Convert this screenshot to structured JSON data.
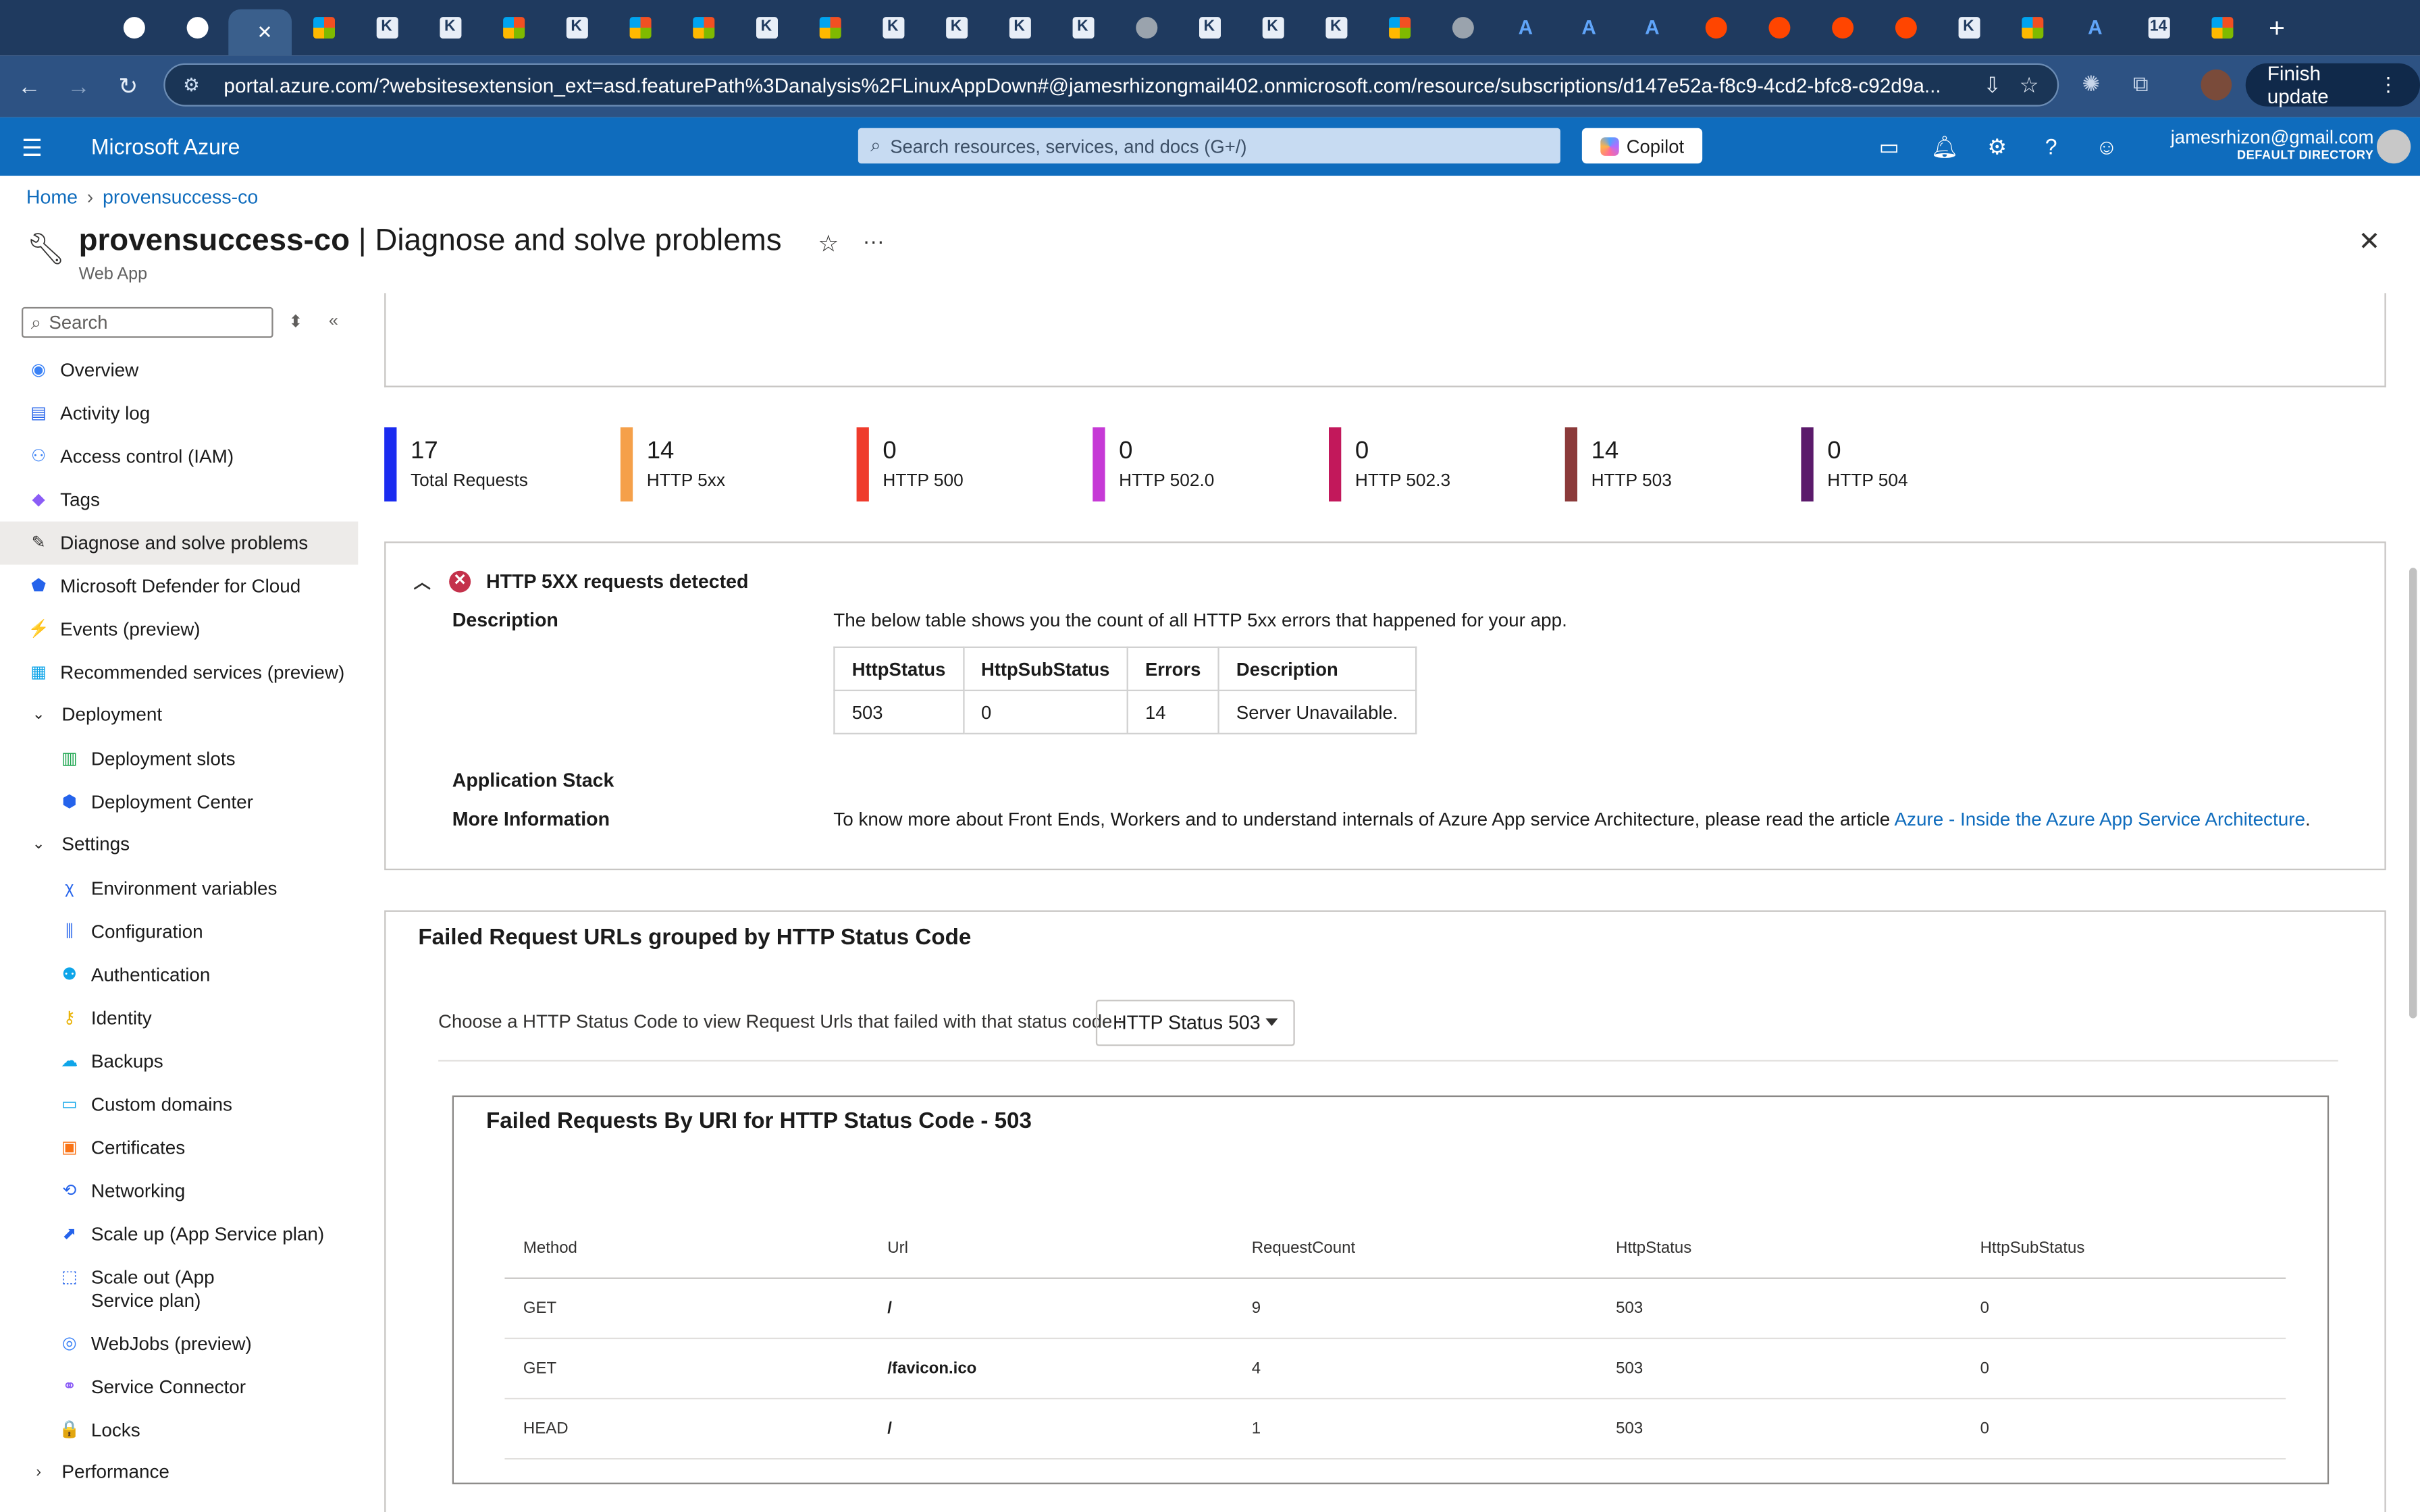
{
  "browser": {
    "tabs": [
      {
        "icon": "github-icon",
        "type": "gh"
      },
      {
        "icon": "refresh-icon",
        "type": "gh"
      },
      {
        "icon": "active-tab",
        "type": "active"
      },
      {
        "icon": "microsoft-icon",
        "type": "ms"
      },
      {
        "icon": "k-icon",
        "type": "k"
      },
      {
        "icon": "k-icon",
        "type": "k"
      },
      {
        "icon": "microsoft-icon",
        "type": "ms"
      },
      {
        "icon": "k-icon",
        "type": "k"
      },
      {
        "icon": "microsoft-icon",
        "type": "ms"
      },
      {
        "icon": "microsoft-icon",
        "type": "ms"
      },
      {
        "icon": "k-icon",
        "type": "k"
      },
      {
        "icon": "microsoft-icon",
        "type": "ms"
      },
      {
        "icon": "k-icon",
        "type": "k"
      },
      {
        "icon": "k-icon",
        "type": "k"
      },
      {
        "icon": "k-icon",
        "type": "k"
      },
      {
        "icon": "k-icon",
        "type": "k"
      },
      {
        "icon": "globe-icon",
        "type": "gl"
      },
      {
        "icon": "k-icon",
        "type": "k"
      },
      {
        "icon": "k-icon",
        "type": "k"
      },
      {
        "icon": "k-icon",
        "type": "k"
      },
      {
        "icon": "microsoft-icon",
        "type": "ms"
      },
      {
        "icon": "globe-icon",
        "type": "gl"
      },
      {
        "icon": "azure-icon",
        "type": "az"
      },
      {
        "icon": "azure-icon",
        "type": "az"
      },
      {
        "icon": "azure-icon",
        "type": "az"
      },
      {
        "icon": "reddit-icon",
        "type": "rd"
      },
      {
        "icon": "reddit-icon",
        "type": "rd"
      },
      {
        "icon": "reddit-icon",
        "type": "rd"
      },
      {
        "icon": "reddit-icon",
        "type": "rd"
      },
      {
        "icon": "k-icon",
        "type": "k"
      },
      {
        "icon": "microsoft-icon",
        "type": "ms"
      },
      {
        "icon": "azure-icon",
        "type": "az"
      },
      {
        "icon": "calendar-icon",
        "type": "k"
      },
      {
        "icon": "microsoft-icon",
        "type": "ms"
      }
    ],
    "k_letter": "K",
    "az_letter": "A",
    "calendar_num": "14",
    "close_glyph": "✕",
    "newtab_glyph": "+",
    "url": "portal.azure.com/?websitesextension_ext=asd.featurePath%3Danalysis%2FLinuxAppDown#@jamesrhizongmail402.onmicrosoft.com/resource/subscriptions/d147e52a-f8c9-4cd2-bfc8-c92d9a...",
    "finish_update": "Finish update"
  },
  "azure": {
    "brand": "Microsoft Azure",
    "search_placeholder": "Search resources, services, and docs (G+/)",
    "copilot": "Copilot",
    "user_email": "jamesrhizon@gmail.com",
    "user_directory": "DEFAULT DIRECTORY"
  },
  "breadcrumb": {
    "home": "Home",
    "resource": "provensuccess-co"
  },
  "page": {
    "title_resource": "provensuccess-co",
    "title_rest": " | Diagnose and solve problems",
    "subtitle": "Web App"
  },
  "sidebar": {
    "search_placeholder": "Search",
    "items": [
      {
        "label": "Overview",
        "icon": "overview-icon",
        "color": "#3b82f6",
        "indent": 0,
        "glyph": "◉"
      },
      {
        "label": "Activity log",
        "icon": "activity-log-icon",
        "color": "#2563eb",
        "indent": 0,
        "glyph": "▤"
      },
      {
        "label": "Access control (IAM)",
        "icon": "iam-icon",
        "color": "#3b82f6",
        "indent": 0,
        "glyph": "⚇"
      },
      {
        "label": "Tags",
        "icon": "tag-icon",
        "color": "#8b5cf6",
        "indent": 0,
        "glyph": "◆"
      },
      {
        "label": "Diagnose and solve problems",
        "icon": "wrench-icon",
        "color": "#323130",
        "indent": 0,
        "glyph": "✎",
        "selected": true
      },
      {
        "label": "Microsoft Defender for Cloud",
        "icon": "shield-icon",
        "color": "#2563eb",
        "indent": 0,
        "glyph": "⬟"
      },
      {
        "label": "Events (preview)",
        "icon": "lightning-icon",
        "color": "#eab308",
        "indent": 0,
        "glyph": "⚡"
      },
      {
        "label": "Recommended services (preview)",
        "icon": "grid-icon",
        "color": "#0ea5e9",
        "indent": 0,
        "glyph": "▦"
      },
      {
        "label": "Deployment",
        "icon": "chevron-down-icon",
        "group": true,
        "glyph": "⌄"
      },
      {
        "label": "Deployment slots",
        "icon": "deployment-slots-icon",
        "color": "#16a34a",
        "indent": 1,
        "glyph": "▥"
      },
      {
        "label": "Deployment Center",
        "icon": "deployment-center-icon",
        "color": "#2563eb",
        "indent": 1,
        "glyph": "⬢"
      },
      {
        "label": "Settings",
        "icon": "chevron-down-icon",
        "group": true,
        "glyph": "⌄"
      },
      {
        "label": "Environment variables",
        "icon": "variables-icon",
        "color": "#2563eb",
        "indent": 1,
        "glyph": "χ"
      },
      {
        "label": "Configuration",
        "icon": "configuration-icon",
        "color": "#2563eb",
        "indent": 1,
        "glyph": "⫼"
      },
      {
        "label": "Authentication",
        "icon": "authentication-icon",
        "color": "#0ea5e9",
        "indent": 1,
        "glyph": "⚉"
      },
      {
        "label": "Identity",
        "icon": "identity-icon",
        "color": "#eab308",
        "indent": 1,
        "glyph": "⚷"
      },
      {
        "label": "Backups",
        "icon": "backups-icon",
        "color": "#0ea5e9",
        "indent": 1,
        "glyph": "☁"
      },
      {
        "label": "Custom domains",
        "icon": "custom-domains-icon",
        "color": "#0ea5e9",
        "indent": 1,
        "glyph": "▭"
      },
      {
        "label": "Certificates",
        "icon": "certificates-icon",
        "color": "#f97316",
        "indent": 1,
        "glyph": "▣"
      },
      {
        "label": "Networking",
        "icon": "networking-icon",
        "color": "#2563eb",
        "indent": 1,
        "glyph": "⟲"
      },
      {
        "label": "Scale up (App Service plan)",
        "icon": "scale-up-icon",
        "color": "#2563eb",
        "indent": 1,
        "glyph": "⬈"
      },
      {
        "label": "Scale out (App Service plan)",
        "icon": "scale-out-icon",
        "color": "#2563eb",
        "indent": 1,
        "glyph": "⬚",
        "twoLine": true
      },
      {
        "label": "WebJobs (preview)",
        "icon": "webjobs-icon",
        "color": "#3b82f6",
        "indent": 1,
        "glyph": "◎"
      },
      {
        "label": "Service Connector",
        "icon": "service-connector-icon",
        "color": "#8b5cf6",
        "indent": 1,
        "glyph": "⚭"
      },
      {
        "label": "Locks",
        "icon": "lock-icon",
        "color": "#2563eb",
        "indent": 1,
        "glyph": "🔒"
      },
      {
        "label": "Performance",
        "icon": "chevron-right-icon",
        "group": true,
        "glyph": "›"
      }
    ]
  },
  "stats": [
    {
      "value": "17",
      "label": "Total Requests",
      "color": "#1a2bf0"
    },
    {
      "value": "14",
      "label": "HTTP 5xx",
      "color": "#f5a04a"
    },
    {
      "value": "0",
      "label": "HTTP 500",
      "color": "#ef3b2c"
    },
    {
      "value": "0",
      "label": "HTTP 502.0",
      "color": "#c63ad6"
    },
    {
      "value": "0",
      "label": "HTTP 502.3",
      "color": "#c2185b"
    },
    {
      "value": "14",
      "label": "HTTP 503",
      "color": "#8b3a3a"
    },
    {
      "value": "0",
      "label": "HTTP 504",
      "color": "#5b1a6b"
    }
  ],
  "detection": {
    "title": "HTTP 5XX requests detected",
    "description_label": "Description",
    "description_text": "The below table shows you the count of all HTTP 5xx errors that happened for your app.",
    "table_headers": [
      "HttpStatus",
      "HttpSubStatus",
      "Errors",
      "Description"
    ],
    "table_rows": [
      [
        "503",
        "0",
        "14",
        "Server Unavailable."
      ]
    ],
    "app_stack_label": "Application Stack",
    "more_info_label": "More Information",
    "more_info_text": "To know more about Front Ends, Workers and to understand internals of Azure App service Architecture, please read the article ",
    "more_info_link": "Azure - Inside the Azure App Service Architecture",
    "more_info_tail": "."
  },
  "failed": {
    "title": "Failed Request URLs grouped by HTTP Status Code",
    "choose_label": "Choose a HTTP Status Code to view Request Urls that failed with that status code :",
    "selected_status": "HTTP Status 503",
    "inner_title": "Failed Requests By URI for HTTP Status Code - 503",
    "columns": [
      "Method",
      "Url",
      "RequestCount",
      "HttpStatus",
      "HttpSubStatus"
    ],
    "rows": [
      [
        "GET",
        "/",
        "9",
        "503",
        "0"
      ],
      [
        "GET",
        "/favicon.ico",
        "4",
        "503",
        "0"
      ],
      [
        "HEAD",
        "/",
        "1",
        "503",
        "0"
      ]
    ]
  }
}
